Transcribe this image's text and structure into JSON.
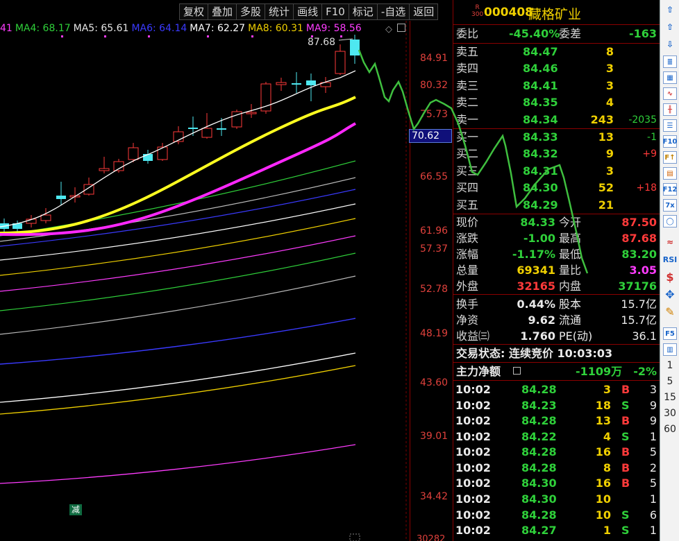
{
  "toolbar": [
    "复权",
    "叠加",
    "多股",
    "统计",
    "画线",
    "F10",
    "标记",
    "-自选",
    "返回"
  ],
  "ma_legend": [
    {
      "text": "41",
      "color": "#ff3cff"
    },
    {
      "text": "MA4: 68.17",
      "color": "#2fd03a"
    },
    {
      "text": "MA5: 65.61",
      "color": "#e6e6e6"
    },
    {
      "text": "MA6: 64.14",
      "color": "#3a3aff"
    },
    {
      "text": "MA7: 62.27",
      "color": "#ffffff"
    },
    {
      "text": "MA8: 60.31",
      "color": "#f0d000"
    },
    {
      "text": "MA9: 58.56",
      "color": "#ff3cff"
    }
  ],
  "chart": {
    "y_ticks": [
      "84.91",
      "80.32",
      "75.73",
      "66.55",
      "61.96",
      "57.37",
      "52.78",
      "48.19",
      "43.60",
      "39.01",
      "34.42"
    ],
    "current_price_tag": "70.62",
    "peak_label": "87.68",
    "bottom_label": "30282",
    "badge": "减",
    "colors": {
      "up": "#ff3a3a",
      "down": "#4ee8f0",
      "ma5": "#ffffff",
      "ma10": "#ffff20",
      "ma20": "#ff28ff",
      "wave": "#3fbf3f"
    }
  },
  "quote": {
    "r_badge": [
      "R",
      "300"
    ],
    "code": "000408",
    "name": "藏格矿业",
    "webi": {
      "label": "委比",
      "value": "-45.40%",
      "label2": "委差",
      "value2": "-163"
    },
    "asks": [
      {
        "label": "卖五",
        "price": "84.47",
        "vol": "8",
        "chg": ""
      },
      {
        "label": "卖四",
        "price": "84.46",
        "vol": "3",
        "chg": ""
      },
      {
        "label": "卖三",
        "price": "84.41",
        "vol": "3",
        "chg": ""
      },
      {
        "label": "卖二",
        "price": "84.35",
        "vol": "4",
        "chg": ""
      },
      {
        "label": "卖一",
        "price": "84.34",
        "vol": "243",
        "chg": "-2035"
      }
    ],
    "bids": [
      {
        "label": "买一",
        "price": "84.33",
        "vol": "13",
        "chg": "-1"
      },
      {
        "label": "买二",
        "price": "84.32",
        "vol": "9",
        "chg": "+9"
      },
      {
        "label": "买三",
        "price": "84.31",
        "vol": "3",
        "chg": ""
      },
      {
        "label": "买四",
        "price": "84.30",
        "vol": "52",
        "chg": "+18"
      },
      {
        "label": "买五",
        "price": "84.29",
        "vol": "21",
        "chg": ""
      }
    ],
    "stats": [
      {
        "l1": "现价",
        "v1": "84.33",
        "c1": "green",
        "l2": "今开",
        "v2": "87.50",
        "c2": "red"
      },
      {
        "l1": "涨跌",
        "v1": "-1.00",
        "c1": "green",
        "l2": "最高",
        "v2": "87.68",
        "c2": "red"
      },
      {
        "l1": "涨幅",
        "v1": "-1.17%",
        "c1": "green",
        "l2": "最低",
        "v2": "83.20",
        "c2": "green"
      },
      {
        "l1": "总量",
        "v1": "69341",
        "c1": "yellow",
        "l2": "量比",
        "v2": "3.05",
        "c2": "mag"
      },
      {
        "l1": "外盘",
        "v1": "32165",
        "c1": "red",
        "l2": "内盘",
        "v2": "37176",
        "c2": "green"
      }
    ],
    "fundamentals": [
      {
        "l1": "换手",
        "v1": "0.44%",
        "l2": "股本",
        "v2": "15.7亿"
      },
      {
        "l1": "净资",
        "v1": "9.62",
        "l2": "流通",
        "v2": "15.7亿"
      },
      {
        "l1": "收益㈢",
        "v1": "1.760",
        "l2": "PE(动)",
        "v2": "36.1"
      }
    ],
    "trade_status": "交易状态: 连续竞价 10:03:03",
    "main_flow": {
      "label": "主力净额",
      "value": "-1109万",
      "pct": "-2%"
    },
    "ticks": [
      {
        "time": "10:02",
        "price": "84.28",
        "vol": "3",
        "side": "B",
        "n": "3"
      },
      {
        "time": "10:02",
        "price": "84.23",
        "vol": "18",
        "side": "S",
        "n": "9"
      },
      {
        "time": "10:02",
        "price": "84.28",
        "vol": "13",
        "side": "B",
        "n": "9"
      },
      {
        "time": "10:02",
        "price": "84.22",
        "vol": "4",
        "side": "S",
        "n": "1"
      },
      {
        "time": "10:02",
        "price": "84.28",
        "vol": "16",
        "side": "B",
        "n": "5"
      },
      {
        "time": "10:02",
        "price": "84.28",
        "vol": "8",
        "side": "B",
        "n": "2"
      },
      {
        "time": "10:02",
        "price": "84.30",
        "vol": "16",
        "side": "B",
        "n": "5"
      },
      {
        "time": "10:02",
        "price": "84.30",
        "vol": "10",
        "side": "",
        "n": "1"
      },
      {
        "time": "10:02",
        "price": "84.28",
        "vol": "10",
        "side": "S",
        "n": "6"
      },
      {
        "time": "10:02",
        "price": "84.27",
        "vol": "1",
        "side": "S",
        "n": "1"
      }
    ]
  },
  "side_bar": {
    "icons": [
      "arrow-up-icon",
      "arrow-down-icon",
      "stock-list-icon",
      "grid-icon",
      "line-chart-icon",
      "candle-icon",
      "list-icon"
    ],
    "boxed": [
      "F10",
      "F↑",
      "≡",
      "F12",
      "7x",
      "◯"
    ],
    "icons2": [
      "zigzag-icon",
      "rsi-icon",
      "dollar-icon",
      "cross-move-icon",
      "pencil-icon"
    ],
    "rsi_label": "RSI",
    "f5_label": "F5",
    "periods": [
      "1",
      "5",
      "15",
      "30",
      "60"
    ]
  }
}
